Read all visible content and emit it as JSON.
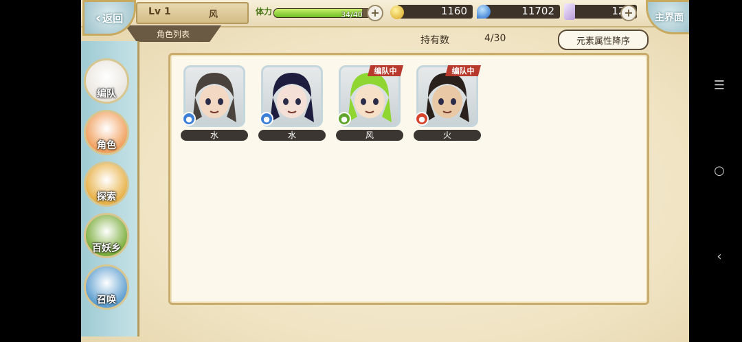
{
  "header": {
    "back_label": "返回",
    "level": "Lv 1",
    "element": "风",
    "list_tab": "角色列表",
    "stamina_label": "体力",
    "stamina_value": "34/40",
    "stamina_fraction": 0.85,
    "gold": "1160",
    "gems": "11702",
    "crystals": "121",
    "home_label": "主界面"
  },
  "owned": {
    "label": "持有数",
    "count": "4/30"
  },
  "sort": {
    "label": "元素属性降序"
  },
  "team_tag": "编队中",
  "characters": [
    {
      "element": "水",
      "in_team": false,
      "elem_color": "#3d7fd6",
      "hair": "#4a423c",
      "skin": "#f3d8c4"
    },
    {
      "element": "水",
      "in_team": false,
      "elem_color": "#3d7fd6",
      "hair": "#1e1d40",
      "skin": "#f4e0d6"
    },
    {
      "element": "风",
      "in_team": true,
      "elem_color": "#5fa62a",
      "hair": "#8fd632",
      "skin": "#f6e0c8"
    },
    {
      "element": "火",
      "in_team": true,
      "elem_color": "#d8442b",
      "hair": "#2a211c",
      "skin": "#e9c9a5"
    }
  ],
  "menu": [
    {
      "label": "编队",
      "color": "#eae6e0"
    },
    {
      "label": "角色",
      "color": "#f1a160"
    },
    {
      "label": "探索",
      "color": "#e8b24a"
    },
    {
      "label": "百妖乡",
      "color": "#7cae3e"
    },
    {
      "label": "召唤",
      "color": "#5f9fd0"
    }
  ]
}
